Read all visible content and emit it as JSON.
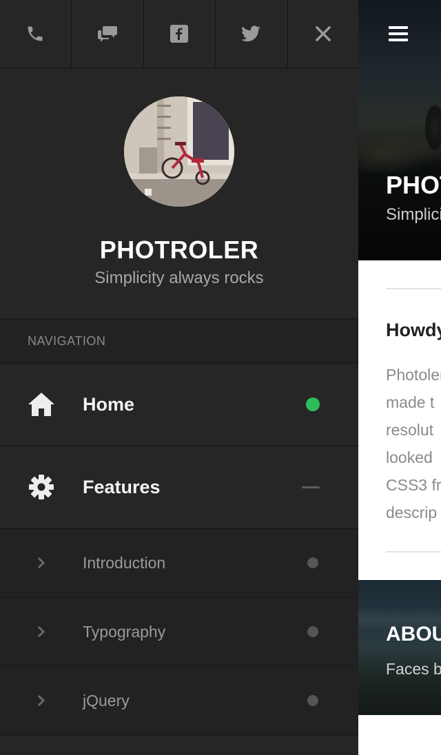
{
  "social": [
    {
      "icon": "phone-icon"
    },
    {
      "icon": "chat-icon"
    },
    {
      "icon": "facebook-icon"
    },
    {
      "icon": "twitter-icon"
    },
    {
      "icon": "close-icon"
    }
  ],
  "profile": {
    "name": "PHOTROLER",
    "tagline": "Simplicity always rocks"
  },
  "navigation": {
    "heading": "NAVIGATION",
    "items": [
      {
        "label": "Home",
        "icon": "home-icon",
        "indicator": "active-dot"
      },
      {
        "label": "Features",
        "icon": "gear-icon",
        "indicator": "collapse-dash"
      }
    ],
    "subitems": [
      {
        "label": "Introduction"
      },
      {
        "label": "Typography"
      },
      {
        "label": "jQuery"
      }
    ]
  },
  "main": {
    "hero_title": "PHOTROLER",
    "hero_subtitle": "Simplicity always rocks",
    "article_heading": "Howdy",
    "article_lines": [
      "Photoler",
      "made t",
      "resolut",
      "looked",
      "CSS3 fr",
      "descrip"
    ],
    "about_title": "ABOUT",
    "about_subtitle": "Faces b"
  },
  "colors": {
    "sidebar_bg": "#262626",
    "accent_active": "#2ebd59",
    "muted_text": "#9a9a9a"
  }
}
